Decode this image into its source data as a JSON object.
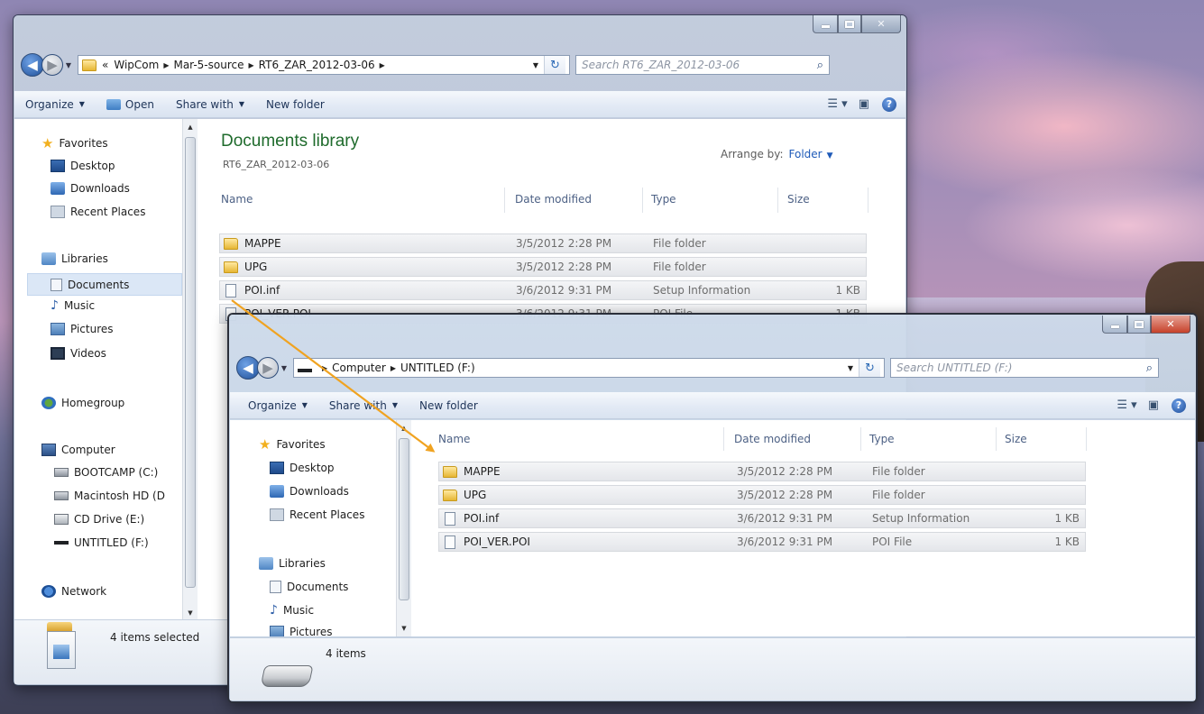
{
  "back_window": {
    "address": {
      "overflow": "«",
      "crumbs": [
        "WipCom",
        "Mar-5-source",
        "RT6_ZAR_2012-03-06"
      ]
    },
    "search_placeholder": "Search RT6_ZAR_2012-03-06",
    "toolbar": {
      "organize": "Organize",
      "open": "Open",
      "share_with": "Share with",
      "new_folder": "New folder"
    },
    "nav": {
      "favorites": "Favorites",
      "desktop": "Desktop",
      "downloads": "Downloads",
      "recent_places": "Recent Places",
      "libraries": "Libraries",
      "documents": "Documents",
      "music": "Music",
      "pictures": "Pictures",
      "videos": "Videos",
      "homegroup": "Homegroup",
      "computer": "Computer",
      "bootcamp": "BOOTCAMP (C:)",
      "macintosh_hd": "Macintosh HD (D",
      "cd_drive": "CD Drive (E:)",
      "untitled": "UNTITLED (F:)",
      "network": "Network"
    },
    "library_title": "Documents library",
    "library_subtitle": "RT6_ZAR_2012-03-06",
    "arrange_label": "Arrange by:",
    "arrange_value": "Folder",
    "columns": {
      "name": "Name",
      "date": "Date modified",
      "type": "Type",
      "size": "Size"
    },
    "files": [
      {
        "name": "MAPPE",
        "date": "3/5/2012 2:28 PM",
        "type": "File folder",
        "size": "",
        "kind": "folder"
      },
      {
        "name": "UPG",
        "date": "3/5/2012 2:28 PM",
        "type": "File folder",
        "size": "",
        "kind": "folder"
      },
      {
        "name": "POI.inf",
        "date": "3/6/2012 9:31 PM",
        "type": "Setup Information",
        "size": "1 KB",
        "kind": "file"
      },
      {
        "name": "POI_VER.POI",
        "date": "3/6/2012 9:31 PM",
        "type": "POI File",
        "size": "1 KB",
        "kind": "file"
      }
    ],
    "status": "4 items selected"
  },
  "front_window": {
    "address": {
      "crumbs": [
        "Computer",
        "UNTITLED (F:)"
      ]
    },
    "search_placeholder": "Search UNTITLED (F:)",
    "toolbar": {
      "organize": "Organize",
      "share_with": "Share with",
      "new_folder": "New folder"
    },
    "nav": {
      "favorites": "Favorites",
      "desktop": "Desktop",
      "downloads": "Downloads",
      "recent_places": "Recent Places",
      "libraries": "Libraries",
      "documents": "Documents",
      "music": "Music",
      "pictures": "Pictures"
    },
    "columns": {
      "name": "Name",
      "date": "Date modified",
      "type": "Type",
      "size": "Size"
    },
    "files": [
      {
        "name": "MAPPE",
        "date": "3/5/2012 2:28 PM",
        "type": "File folder",
        "size": "",
        "kind": "folder"
      },
      {
        "name": "UPG",
        "date": "3/5/2012 2:28 PM",
        "type": "File folder",
        "size": "",
        "kind": "folder"
      },
      {
        "name": "POI.inf",
        "date": "3/6/2012 9:31 PM",
        "type": "Setup Information",
        "size": "1 KB",
        "kind": "file"
      },
      {
        "name": "POI_VER.POI",
        "date": "3/6/2012 9:31 PM",
        "type": "POI File",
        "size": "1 KB",
        "kind": "file"
      }
    ],
    "status": "4 items"
  },
  "colors": {
    "drag_arrow": "#f0a321",
    "library_title": "#1f6b2c",
    "link_blue": "#1e5ab8"
  }
}
